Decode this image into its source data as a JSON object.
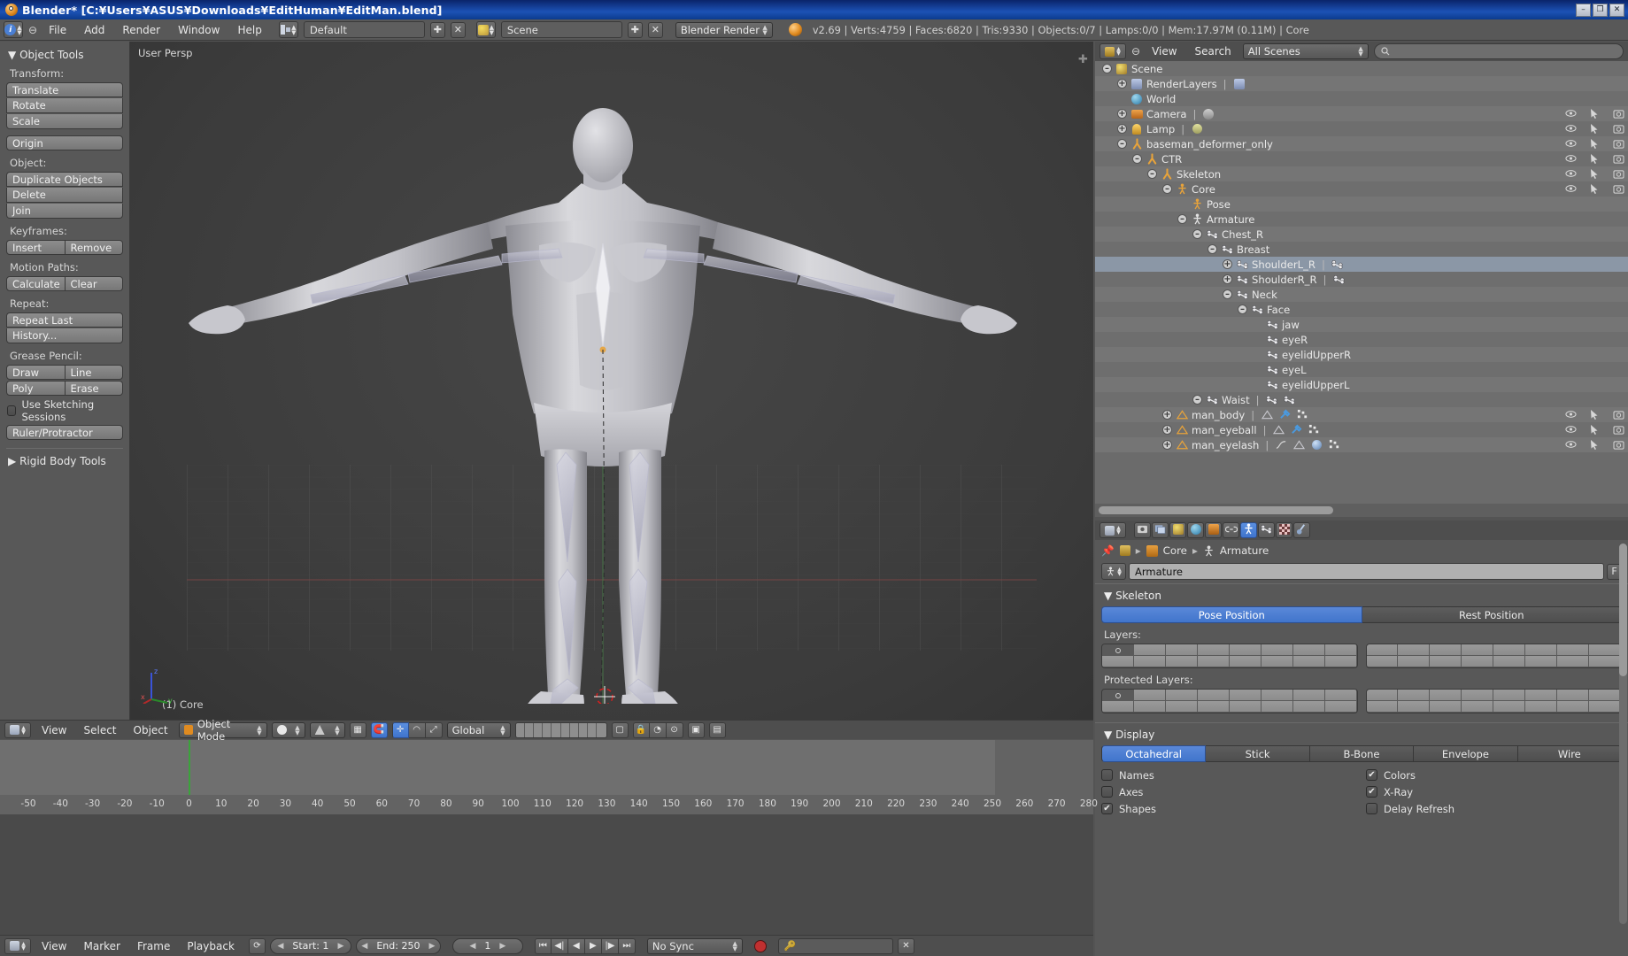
{
  "window": {
    "title": "Blender*  [C:¥Users¥ASUS¥Downloads¥EditHuman¥EditMan.blend]",
    "app_icon": "blender-logo-icon",
    "minimize": "–",
    "maximize": "❐",
    "close": "✕"
  },
  "menubar": {
    "editor_icon": "info-editor-icon",
    "collapse_icon": "⊖",
    "menus": [
      "File",
      "Add",
      "Render",
      "Window",
      "Help"
    ],
    "screen_layout": {
      "icon": "screen-layout-icon",
      "value": "Default",
      "add": "✚",
      "remove": "✕"
    },
    "scene": {
      "icon": "scene-icon",
      "value": "Scene",
      "add": "✚",
      "remove": "✕"
    },
    "render_engine": "Blender Render",
    "status_icon": "blender-icon",
    "status_text": "v2.69 | Verts:4759 | Faces:6820 | Tris:9330 | Objects:0/7 | Lamps:0/0 | Mem:17.97M (0.11M) | Core"
  },
  "toolshelf": {
    "panel_title": "Object Tools",
    "collapse_arrow": "▼",
    "groups": [
      {
        "label": "Transform:",
        "buttons": [
          "Translate",
          "Rotate",
          "Scale"
        ]
      },
      {
        "label": "",
        "buttons": [
          "Origin"
        ]
      },
      {
        "label": "Object:",
        "buttons": [
          "Duplicate Objects",
          "Delete",
          "Join"
        ]
      },
      {
        "label": "Keyframes:",
        "row": [
          "Insert",
          "Remove"
        ]
      },
      {
        "label": "Motion Paths:",
        "row": [
          "Calculate",
          "Clear"
        ]
      },
      {
        "label": "Repeat:",
        "buttons": [
          "Repeat Last",
          "History..."
        ]
      },
      {
        "label": "Grease Pencil:",
        "row2": [
          [
            "Draw",
            "Line"
          ],
          [
            "Poly",
            "Erase"
          ]
        ]
      }
    ],
    "sketching_checkbox": "Use Sketching Sessions",
    "ruler_button": "Ruler/Protractor",
    "rigid_body_title": "Rigid Body Tools",
    "rigid_body_arrow": "▶"
  },
  "viewport": {
    "perspective_label": "User Persp",
    "object_info": "(1) Core",
    "axis_x": "x",
    "axis_y": "y",
    "axis_z": "z",
    "add_panel_icon": "✚"
  },
  "view3d_header": {
    "editor_icon": "3d-view-editor-icon",
    "menus": [
      "View",
      "Select",
      "Object"
    ],
    "mode": "Object Mode",
    "mode_icon": "object-mode-icon",
    "shading": "solid-shading-icon",
    "pivot": "pivot-median-icon",
    "snap_icon": "magnet-icon",
    "manipulator_icons": [
      "translate-manipulator-icon",
      "rotate-manipulator-icon",
      "scale-manipulator-icon"
    ],
    "transform_orientation": "Global",
    "layer_icon": "layers-icon",
    "extra_icons": [
      "render-region-icon",
      "lock-icon",
      "proportional-edit-icon",
      "camera-icon",
      "texture-icon"
    ]
  },
  "outliner": {
    "editor_icon": "outliner-editor-icon",
    "collapse_icon": "⊖",
    "menus": [
      "View",
      "Search"
    ],
    "display_mode": "All Scenes",
    "filter_placeholder": "",
    "filter_icon": "search-icon",
    "scrollbar": "horizontal-scrollbar",
    "rows": [
      {
        "indent": 0,
        "expander": "⊖",
        "icon": "scene-icon",
        "label": "Scene",
        "restrict": []
      },
      {
        "indent": 1,
        "expander": "⊕",
        "icon": "renderlayers-icon",
        "label": "RenderLayers",
        "sep": true,
        "extra": [
          "renderlayer-icon"
        ],
        "restrict": []
      },
      {
        "indent": 1,
        "expander": "",
        "icon": "world-icon",
        "label": "World",
        "restrict": []
      },
      {
        "indent": 1,
        "expander": "⊕",
        "icon": "camera-icon",
        "label": "Camera",
        "sep": true,
        "extra": [
          "camera-data-icon"
        ],
        "restrict": [
          "eye",
          "cursor",
          "camera"
        ]
      },
      {
        "indent": 1,
        "expander": "⊕",
        "icon": "lamp-icon",
        "label": "Lamp",
        "sep": true,
        "extra": [
          "lamp-data-icon"
        ],
        "restrict": [
          "eye",
          "cursor",
          "camera"
        ]
      },
      {
        "indent": 1,
        "expander": "⊖",
        "icon": "armature-icon",
        "label": "baseman_deformer_only",
        "restrict": [
          "eye",
          "cursor",
          "camera"
        ]
      },
      {
        "indent": 2,
        "expander": "⊖",
        "icon": "armature-icon",
        "label": "CTR",
        "restrict": [
          "eye",
          "cursor",
          "camera"
        ]
      },
      {
        "indent": 3,
        "expander": "⊖",
        "icon": "armature-icon",
        "label": "Skeleton",
        "restrict": [
          "eye",
          "cursor",
          "camera"
        ]
      },
      {
        "indent": 4,
        "expander": "⊖",
        "icon": "armature-object-icon",
        "label": "Core",
        "restrict": [
          "eye",
          "cursor",
          "camera"
        ]
      },
      {
        "indent": 5,
        "expander": "",
        "icon": "pose-icon",
        "label": "Pose",
        "restrict": []
      },
      {
        "indent": 5,
        "expander": "⊖",
        "icon": "armature-data-icon",
        "label": "Armature",
        "restrict": []
      },
      {
        "indent": 6,
        "expander": "⊖",
        "icon": "bone-icon",
        "label": "Chest_R",
        "restrict": []
      },
      {
        "indent": 7,
        "expander": "⊖",
        "icon": "bone-icon",
        "label": "Breast",
        "restrict": []
      },
      {
        "indent": 8,
        "expander": "⊕",
        "icon": "bone-icon",
        "label": "ShoulderL_R",
        "sep": true,
        "extra": [
          "bone-icon"
        ],
        "selected": true,
        "restrict": []
      },
      {
        "indent": 8,
        "expander": "⊕",
        "icon": "bone-icon",
        "label": "ShoulderR_R",
        "sep": true,
        "extra": [
          "bone-icon"
        ],
        "restrict": []
      },
      {
        "indent": 8,
        "expander": "⊖",
        "icon": "bone-icon",
        "label": "Neck",
        "restrict": []
      },
      {
        "indent": 9,
        "expander": "⊖",
        "icon": "bone-icon",
        "label": "Face",
        "restrict": []
      },
      {
        "indent": 10,
        "expander": "",
        "icon": "bone-icon",
        "label": "jaw",
        "restrict": []
      },
      {
        "indent": 10,
        "expander": "",
        "icon": "bone-icon",
        "label": "eyeR",
        "restrict": []
      },
      {
        "indent": 10,
        "expander": "",
        "icon": "bone-icon",
        "label": "eyelidUpperR",
        "restrict": []
      },
      {
        "indent": 10,
        "expander": "",
        "icon": "bone-icon",
        "label": "eyeL",
        "restrict": []
      },
      {
        "indent": 10,
        "expander": "",
        "icon": "bone-icon",
        "label": "eyelidUpperL",
        "restrict": []
      },
      {
        "indent": 6,
        "expander": "⊖",
        "icon": "bone-icon",
        "label": "Waist",
        "sep": true,
        "extra": [
          "bone-icon",
          "bone-icon"
        ],
        "restrict": []
      },
      {
        "indent": 4,
        "expander": "⊕",
        "icon": "mesh-icon",
        "label": "man_body",
        "sep": true,
        "extra": [
          "mesh-data-icon",
          "modifier-icon",
          "vertexgroup-icon"
        ],
        "restrict": [
          "eye",
          "cursor",
          "camera"
        ]
      },
      {
        "indent": 4,
        "expander": "⊕",
        "icon": "mesh-icon",
        "label": "man_eyeball",
        "sep": true,
        "extra": [
          "mesh-data-icon",
          "modifier-icon",
          "vertexgroup-icon"
        ],
        "restrict": [
          "eye",
          "cursor",
          "camera"
        ]
      },
      {
        "indent": 4,
        "expander": "⊕",
        "icon": "mesh-icon",
        "label": "man_eyelash",
        "sep": true,
        "extra": [
          "curve-icon",
          "mesh-data-icon",
          "material-icon",
          "vertexgroup-icon"
        ],
        "restrict": [
          "eye",
          "cursor",
          "camera"
        ]
      }
    ]
  },
  "properties": {
    "editor_icon": "properties-editor-icon",
    "tabs": [
      {
        "name": "render-tab",
        "icon": "camera-back-icon",
        "active": false
      },
      {
        "name": "renderlayers-tab",
        "icon": "images-icon",
        "active": false
      },
      {
        "name": "scene-tab",
        "icon": "scene-icon",
        "active": false
      },
      {
        "name": "world-tab",
        "icon": "world-icon",
        "active": false
      },
      {
        "name": "object-tab",
        "icon": "cube-icon",
        "active": false
      },
      {
        "name": "constraints-tab",
        "icon": "chain-icon",
        "active": false
      },
      {
        "name": "armature-data-tab",
        "icon": "armature-man-icon",
        "active": true
      },
      {
        "name": "bone-tab",
        "icon": "bone-icon",
        "active": false
      },
      {
        "name": "bone-constraint-tab",
        "icon": "checker-icon",
        "active": false
      },
      {
        "name": "physics-tab",
        "icon": "physics-icon",
        "active": false
      }
    ],
    "breadcrumb": {
      "pin_icon": "pin-icon",
      "scene_icon": "scene-icon",
      "object": "Core",
      "object_icon": "cube-icon",
      "data": "Armature",
      "data_icon": "armature-man-icon",
      "sep": "▸"
    },
    "id_field": {
      "icon": "armature-man-icon",
      "value": "Armature",
      "fake_user": "F"
    },
    "skeleton": {
      "title": "Skeleton",
      "arrow": "▼",
      "pose_position": "Pose Position",
      "rest_position": "Rest Position",
      "active_position": "Pose Position",
      "layers_label": "Layers:",
      "protected_label": "Protected Layers:"
    },
    "display": {
      "title": "Display",
      "arrow": "▼",
      "types": [
        "Octahedral",
        "Stick",
        "B-Bone",
        "Envelope",
        "Wire"
      ],
      "active_type": "Octahedral",
      "options_left": [
        {
          "label": "Names",
          "checked": false
        },
        {
          "label": "Axes",
          "checked": false
        },
        {
          "label": "Shapes",
          "checked": true
        }
      ],
      "options_right": [
        {
          "label": "Colors",
          "checked": true
        },
        {
          "label": "X-Ray",
          "checked": true
        },
        {
          "label": "Delay Refresh",
          "checked": false
        }
      ]
    },
    "accent_blue": "#4a7fd4"
  },
  "timeline": {
    "editor_icon": "timeline-editor-icon",
    "menus": [
      "View",
      "Marker",
      "Frame",
      "Playback"
    ],
    "sync_icon": "sync-icon",
    "start_label": "Start: 1",
    "end_label": "End: 250",
    "current_frame": "1",
    "sync_mode": "No Sync",
    "record_icon": "record-icon",
    "search_placeholder": "",
    "transport": [
      "jump-start-icon",
      "prev-keyframe-icon",
      "play-reverse-icon",
      "play-icon",
      "next-keyframe-icon",
      "jump-end-icon"
    ],
    "ruler_ticks": [
      "-50",
      "-40",
      "-30",
      "-20",
      "-10",
      "0",
      "10",
      "20",
      "30",
      "40",
      "50",
      "60",
      "70",
      "80",
      "90",
      "100",
      "110",
      "120",
      "130",
      "140",
      "150",
      "160",
      "170",
      "180",
      "190",
      "200",
      "210",
      "220",
      "230",
      "240",
      "250",
      "260",
      "270",
      "280"
    ],
    "playhead_frame": 1
  }
}
